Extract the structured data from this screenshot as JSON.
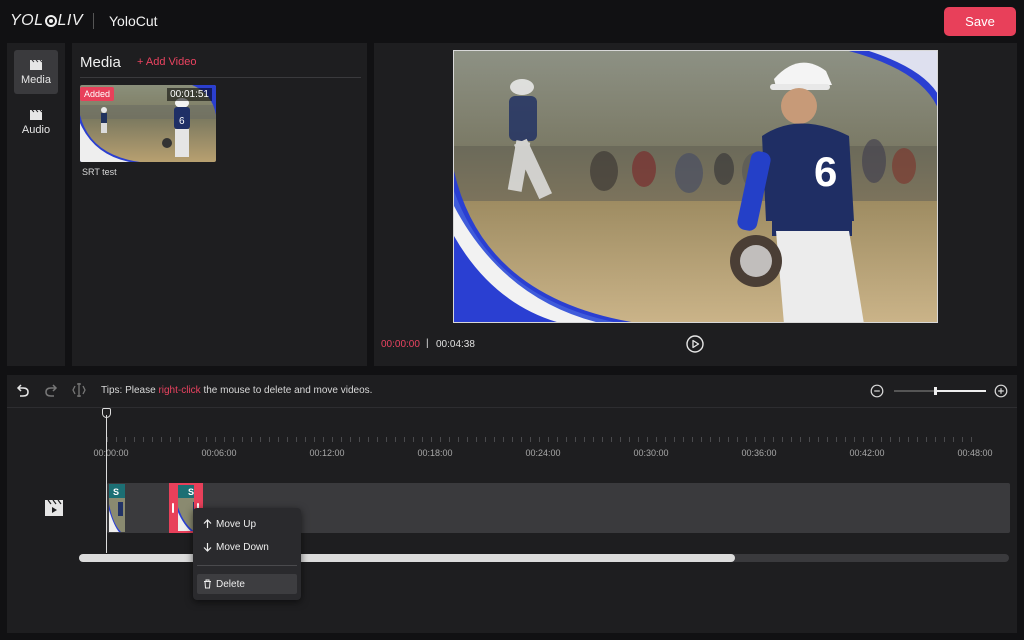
{
  "header": {
    "logo_text": "YOLOLIV",
    "logo_left": "YOL",
    "logo_right": "LIV",
    "app_title": "YoloCut",
    "save_label": "Save"
  },
  "sidebar": {
    "items": [
      {
        "label": "Media",
        "icon": "film-icon",
        "active": true
      },
      {
        "label": "Audio",
        "icon": "film-icon",
        "active": false
      }
    ]
  },
  "media": {
    "title": "Media",
    "add_label": "+ Add Video",
    "items": [
      {
        "name": "SRT test",
        "badge": "Added",
        "duration": "00:01:51"
      }
    ]
  },
  "preview": {
    "current_time": "00:00:00",
    "separator": "|",
    "total_time": "00:04:38"
  },
  "timeline": {
    "tips_prefix": "Tips: Please ",
    "tips_highlight": "right-click",
    "tips_suffix": " the mouse to delete and move videos.",
    "tick_labels": [
      "00:00:00",
      "00:06:00",
      "00:12:00",
      "00:18:00",
      "00:24:00",
      "00:30:00",
      "00:36:00",
      "00:42:00",
      "00:48:00"
    ],
    "zoom_level": 0.45,
    "scroll_fraction": 0.705,
    "clips": [
      {
        "label": "S"
      },
      {
        "label": "S"
      }
    ]
  },
  "context_menu": {
    "move_up": "Move Up",
    "move_down": "Move Down",
    "delete": "Delete"
  },
  "colors": {
    "accent": "#e8405a",
    "panel": "#1e1e20",
    "background": "#111113"
  }
}
